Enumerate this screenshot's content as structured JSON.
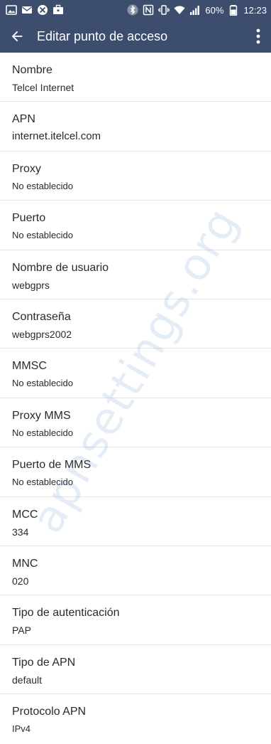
{
  "status_bar": {
    "icons_left": [
      "image-icon",
      "mail-icon",
      "blocked-icon",
      "briefcase-icon"
    ],
    "icons_right": [
      "bluetooth-icon",
      "nfc-icon",
      "vibrate-icon",
      "wifi-icon",
      "signal-icon"
    ],
    "battery": "60%",
    "time": "12:23",
    "background_color": "#3d4d6e"
  },
  "app_bar": {
    "title": "Editar punto de acceso",
    "back_icon": "arrow-back-icon",
    "menu_icon": "more-vert-icon"
  },
  "fields": [
    {
      "label": "Nombre",
      "value": "Telcel Internet"
    },
    {
      "label": "APN",
      "value": "internet.itelcel.com"
    },
    {
      "label": "Proxy",
      "value": "No establecido"
    },
    {
      "label": "Puerto",
      "value": "No establecido"
    },
    {
      "label": "Nombre de usuario",
      "value": "webgprs"
    },
    {
      "label": "Contraseña",
      "value": "webgprs2002"
    },
    {
      "label": "MMSC",
      "value": "No establecido"
    },
    {
      "label": "Proxy MMS",
      "value": "No establecido"
    },
    {
      "label": "Puerto de MMS",
      "value": "No establecido"
    },
    {
      "label": "MCC",
      "value": "334"
    },
    {
      "label": "MNC",
      "value": "020"
    },
    {
      "label": "Tipo de autenticación",
      "value": "PAP"
    },
    {
      "label": "Tipo de APN",
      "value": "default"
    },
    {
      "label": "Protocolo APN",
      "value": "IPv4"
    }
  ],
  "watermark": "apnsettings.org"
}
